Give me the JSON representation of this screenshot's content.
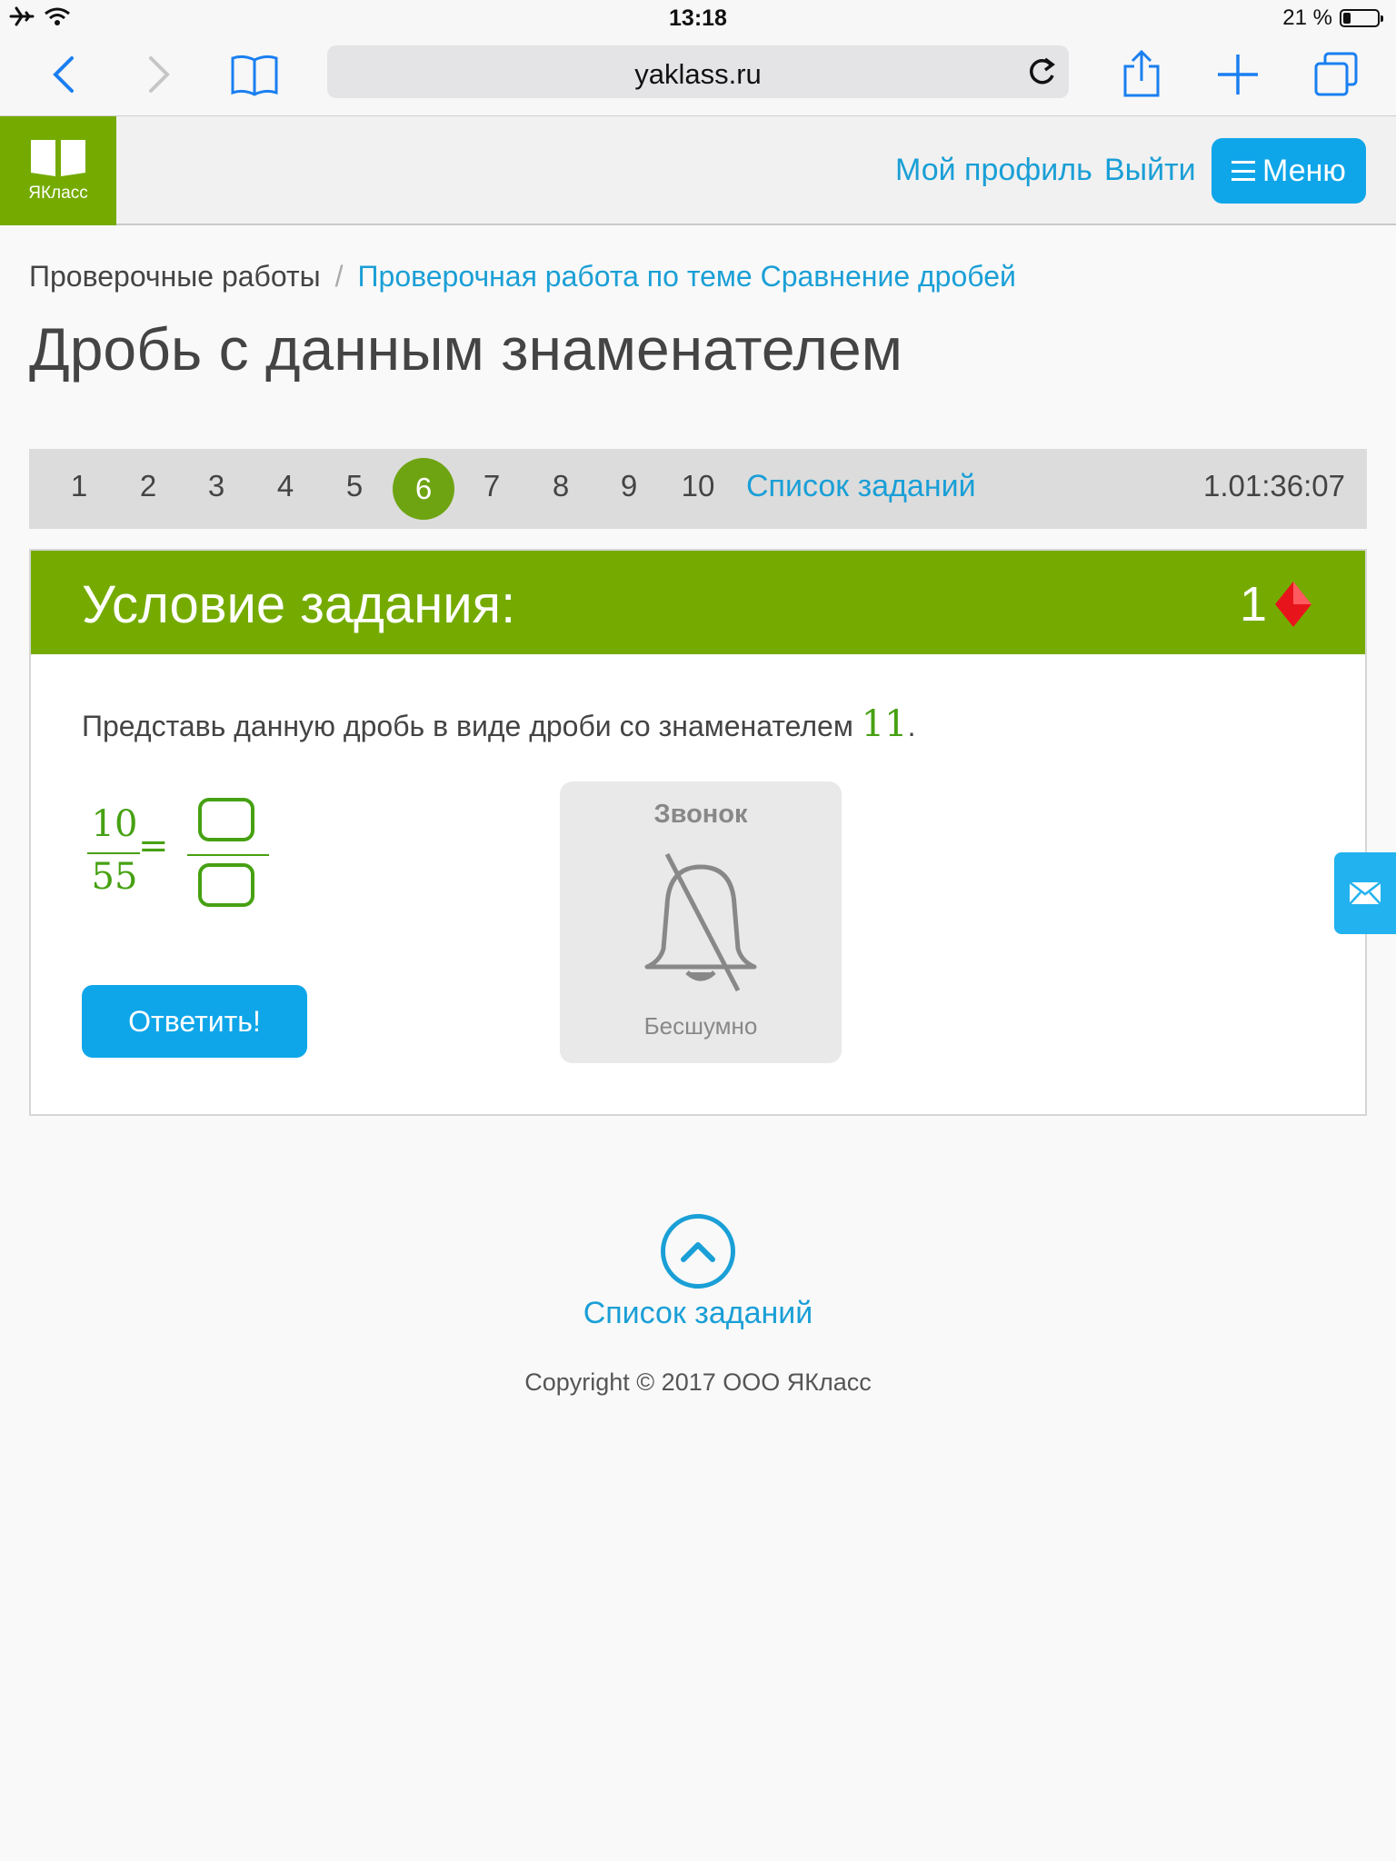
{
  "status_bar": {
    "time": "13:18",
    "battery_text": "21 %",
    "battery_level": 0.21
  },
  "browser": {
    "url": "yaklass.ru",
    "icons": [
      "back-icon",
      "forward-icon",
      "bookmarks-icon",
      "reload-icon",
      "share-icon",
      "new-tab-icon",
      "tabs-icon"
    ]
  },
  "site_header": {
    "logo_text": "ЯКласс",
    "profile_link": "Мой профиль",
    "logout_link": "Выйти",
    "menu_label": "Меню"
  },
  "breadcrumb": {
    "first": "Проверочные работы",
    "separator": "/",
    "current": "Проверочная работа по теме Сравнение дробей"
  },
  "page_title": "Дробь с данным знаменателем",
  "task_nav": {
    "numbers": [
      "1",
      "2",
      "3",
      "4",
      "5",
      "6",
      "7",
      "8",
      "9",
      "10"
    ],
    "active": "6",
    "list_link": "Список заданий",
    "timer": "1.01:36:07"
  },
  "task": {
    "header": "Условие задания:",
    "points": "1",
    "prompt": "Представь данную дробь в виде дроби со знаменателем",
    "target_denominator": "11",
    "prompt_end": ".",
    "numerator": "10",
    "denominator": "55",
    "equals": "=",
    "numerator_input": "",
    "denominator_input": "",
    "answer_button": "Ответить!"
  },
  "bell": {
    "title": "Звонок",
    "subtitle": "Бесшумно"
  },
  "footer": {
    "list_link": "Список заданий",
    "copyright": "Copyright © 2017 ООО ЯКласс"
  },
  "colors": {
    "green": "#75ab00",
    "blue": "#0fa6e9",
    "link": "#1a9fd6"
  }
}
